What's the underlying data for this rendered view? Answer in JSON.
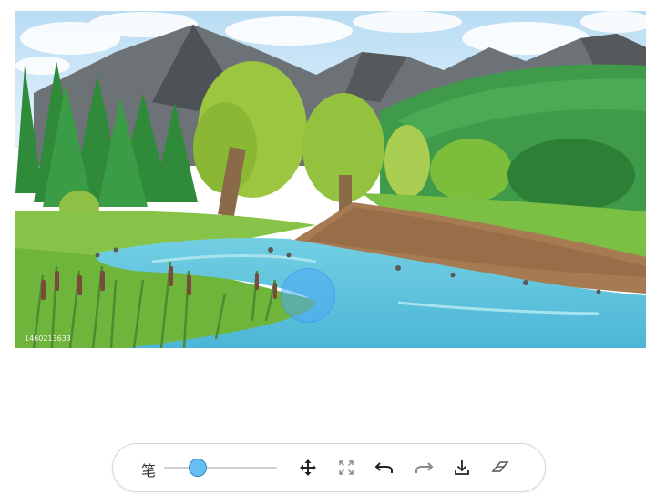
{
  "canvas": {
    "watermark": "1460213633",
    "scene": "river-landscape-illustration"
  },
  "toolbar": {
    "pen_label": "笔",
    "brush_size": 0.3,
    "colors": {
      "knob": "#65bff2",
      "icon": "#333333",
      "icon_disabled": "#9a9a9a"
    },
    "icons": [
      "move-icon",
      "fit-screen-icon",
      "undo-icon",
      "redo-icon",
      "download-icon",
      "eraser-icon"
    ]
  }
}
